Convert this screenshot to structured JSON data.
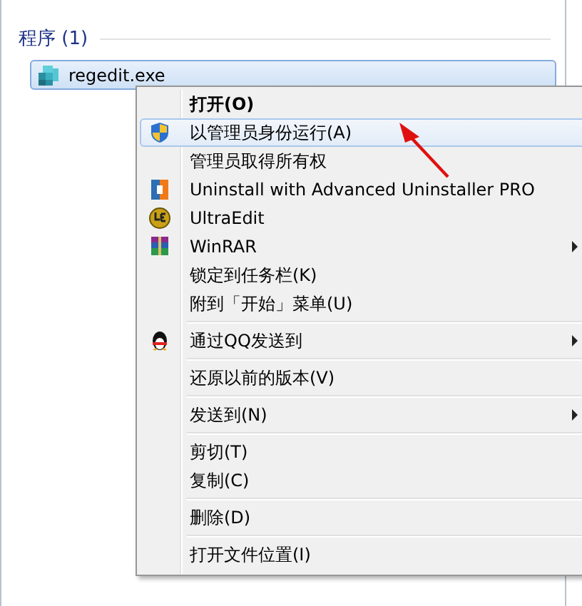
{
  "group": {
    "title": "程序 (1)"
  },
  "result": {
    "label": "regedit.exe",
    "selected": true
  },
  "menu": {
    "items": [
      {
        "kind": "item",
        "label": "打开(O)",
        "bold": true,
        "selected": false,
        "submenu": false
      },
      {
        "kind": "item",
        "label": "以管理员身份运行(A)",
        "bold": false,
        "selected": true,
        "submenu": false
      },
      {
        "kind": "item",
        "label": "管理员取得所有权",
        "bold": false,
        "selected": false,
        "submenu": false
      },
      {
        "kind": "item",
        "label": "Uninstall with Advanced Uninstaller PRO",
        "bold": false,
        "selected": false,
        "submenu": false
      },
      {
        "kind": "item",
        "label": "UltraEdit",
        "bold": false,
        "selected": false,
        "submenu": false
      },
      {
        "kind": "item",
        "label": "WinRAR",
        "bold": false,
        "selected": false,
        "submenu": true
      },
      {
        "kind": "item",
        "label": "锁定到任务栏(K)",
        "bold": false,
        "selected": false,
        "submenu": false
      },
      {
        "kind": "item",
        "label": "附到「开始」菜单(U)",
        "bold": false,
        "selected": false,
        "submenu": false
      },
      {
        "kind": "separator"
      },
      {
        "kind": "item",
        "label": "通过QQ发送到",
        "bold": false,
        "selected": false,
        "submenu": true
      },
      {
        "kind": "separator"
      },
      {
        "kind": "item",
        "label": "还原以前的版本(V)",
        "bold": false,
        "selected": false,
        "submenu": false
      },
      {
        "kind": "separator"
      },
      {
        "kind": "item",
        "label": "发送到(N)",
        "bold": false,
        "selected": false,
        "submenu": true
      },
      {
        "kind": "separator"
      },
      {
        "kind": "item",
        "label": "剪切(T)",
        "bold": false,
        "selected": false,
        "submenu": false
      },
      {
        "kind": "item",
        "label": "复制(C)",
        "bold": false,
        "selected": false,
        "submenu": false
      },
      {
        "kind": "separator"
      },
      {
        "kind": "item",
        "label": "删除(D)",
        "bold": false,
        "selected": false,
        "submenu": false
      },
      {
        "kind": "separator"
      },
      {
        "kind": "item",
        "label": "打开文件位置(I)",
        "bold": false,
        "selected": false,
        "submenu": false
      }
    ]
  }
}
